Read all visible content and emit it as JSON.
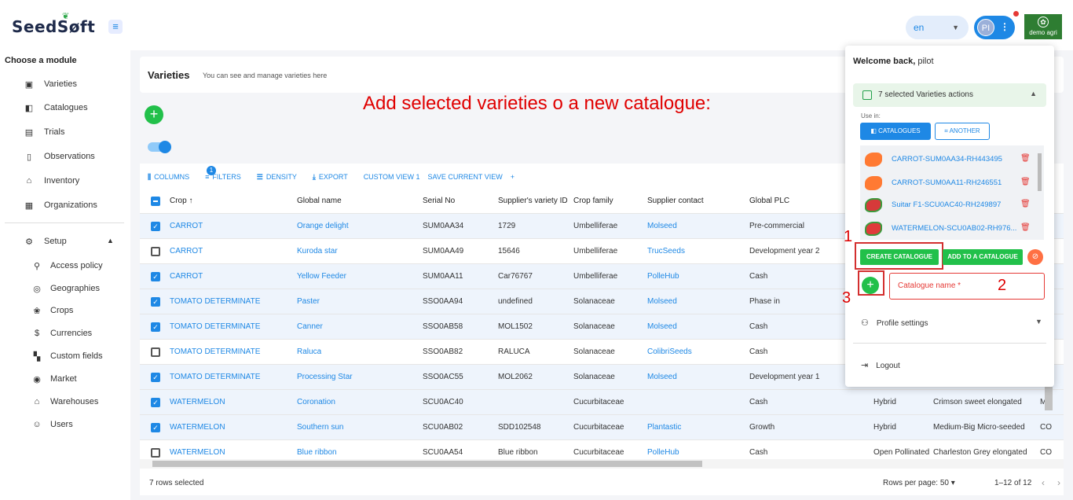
{
  "header": {
    "logo_text": "SeedSøft",
    "language": "en",
    "user_initials": "PI",
    "brand": "demo agri"
  },
  "sidebar": {
    "title": "Choose a module",
    "items": [
      {
        "label": "Varieties",
        "icon": "varieties-icon"
      },
      {
        "label": "Catalogues",
        "icon": "catalogues-icon"
      },
      {
        "label": "Trials",
        "icon": "trials-icon"
      },
      {
        "label": "Observations",
        "icon": "observations-icon"
      },
      {
        "label": "Inventory",
        "icon": "inventory-icon"
      },
      {
        "label": "Organizations",
        "icon": "organizations-icon"
      }
    ],
    "setup_label": "Setup",
    "setup_items": [
      {
        "label": "Access policy"
      },
      {
        "label": "Geographies"
      },
      {
        "label": "Crops"
      },
      {
        "label": "Currencies"
      },
      {
        "label": "Custom fields"
      },
      {
        "label": "Market"
      },
      {
        "label": "Warehouses"
      },
      {
        "label": "Users"
      }
    ]
  },
  "page": {
    "title": "Varieties",
    "subtitle": "You can see and manage varieties here",
    "annotation": "Add selected varieties o a new catalogue:"
  },
  "toolbar": {
    "columns": "COLUMNS",
    "filters": "FILTERS",
    "filter_count": "1",
    "density": "DENSITY",
    "export": "EXPORT",
    "custom_view": "CUSTOM VIEW 1",
    "save_view": "SAVE CURRENT VIEW",
    "add": "+"
  },
  "table": {
    "headers": [
      "Crop ↑",
      "Global name",
      "Serial No",
      "Supplier's variety ID",
      "Crop family",
      "Supplier contact",
      "Global PLC"
    ],
    "rows": [
      {
        "selected": true,
        "crop": "CARROT",
        "name": "Orange delight",
        "serial": "SUM0AA34",
        "supplier_id": "1729",
        "family": "Umbelliferae",
        "contact": "Molseed",
        "plc": "Pre-commercial",
        "extra1": "",
        "extra2": "",
        "extra3": ""
      },
      {
        "selected": false,
        "crop": "CARROT",
        "name": "Kuroda star",
        "serial": "SUM0AA49",
        "supplier_id": "15646",
        "family": "Umbelliferae",
        "contact": "TrucSeeds",
        "plc": "Development year 2",
        "extra1": "",
        "extra2": "",
        "extra3": ""
      },
      {
        "selected": true,
        "crop": "CARROT",
        "name": "Yellow Feeder",
        "serial": "SUM0AA11",
        "supplier_id": "Car76767",
        "family": "Umbelliferae",
        "contact": "PolleHub",
        "plc": "Cash",
        "extra1": "",
        "extra2": "",
        "extra3": ""
      },
      {
        "selected": true,
        "crop": "TOMATO DETERMINATE",
        "name": "Paster",
        "serial": "SSO0AA94",
        "supplier_id": "undefined",
        "family": "Solanaceae",
        "contact": "Molseed",
        "plc": "Phase in",
        "extra1": "",
        "extra2": "",
        "extra3": ""
      },
      {
        "selected": true,
        "crop": "TOMATO DETERMINATE",
        "name": "Canner",
        "serial": "SSO0AB58",
        "supplier_id": "MOL1502",
        "family": "Solanaceae",
        "contact": "Molseed",
        "plc": "Cash",
        "extra1": "",
        "extra2": "",
        "extra3": ""
      },
      {
        "selected": false,
        "crop": "TOMATO DETERMINATE",
        "name": "Raluca",
        "serial": "SSO0AB82",
        "supplier_id": "RALUCA",
        "family": "Solanaceae",
        "contact": "ColibriSeeds",
        "plc": "Cash",
        "extra1": "",
        "extra2": "",
        "extra3": ""
      },
      {
        "selected": true,
        "crop": "TOMATO DETERMINATE",
        "name": "Processing Star",
        "serial": "SSO0AC55",
        "supplier_id": "MOL2062",
        "family": "Solanaceae",
        "contact": "Molseed",
        "plc": "Development year 1",
        "extra1": "",
        "extra2": "",
        "extra3": ""
      },
      {
        "selected": true,
        "crop": "WATERMELON",
        "name": "Coronation",
        "serial": "SCU0AC40",
        "supplier_id": "",
        "family": "Cucurbitaceae",
        "contact": "",
        "plc": "Cash",
        "extra1": "Hybrid",
        "extra2": "Crimson sweet elongated",
        "extra3": "ME"
      },
      {
        "selected": true,
        "crop": "WATERMELON",
        "name": "Southern sun",
        "serial": "SCU0AB02",
        "supplier_id": "SDD102548",
        "family": "Cucurbitaceae",
        "contact": "Plantastic",
        "plc": "Growth",
        "extra1": "Hybrid",
        "extra2": "Medium-Big Micro-seeded",
        "extra3": "CO"
      },
      {
        "selected": false,
        "crop": "WATERMELON",
        "name": "Blue ribbon",
        "serial": "SCU0AA54",
        "supplier_id": "Blue ribbon",
        "family": "Cucurbitaceae",
        "contact": "PolleHub",
        "plc": "Cash",
        "extra1": "Open Pollinated",
        "extra2": "Charleston Grey elongated",
        "extra3": "CO"
      }
    ]
  },
  "footer": {
    "selected": "7 rows selected",
    "rows_per_page_label": "Rows per page:",
    "rows_per_page": "50",
    "range": "1–12 of 12",
    "prev": "‹",
    "next": "›"
  },
  "panel": {
    "welcome_prefix": "Welcome back,",
    "welcome_user": "pilot",
    "actions_label": "7 selected Varieties actions",
    "use_in": "Use in:",
    "catalogues_btn": "CATALOGUES",
    "another_btn": "ANOTHER",
    "list": [
      {
        "label": "CARROT-SUM0AA34-RH443495",
        "color": "#ff7a33"
      },
      {
        "label": "CARROT-SUM0AA11-RH246551",
        "color": "#ff7a33"
      },
      {
        "label": "Suitar F1-SCU0AC40-RH249897",
        "color": "#3c9a3c"
      },
      {
        "label": "WATERMELON-SCU0AB02-RH976...",
        "color": "#e03a3a"
      }
    ],
    "create_btn": "CREATE CATALOGUE",
    "addto_btn": "ADD TO A CATALOGUE",
    "catalogue_placeholder": "Catalogue name *",
    "profile": "Profile settings",
    "logout": "Logout",
    "marker1": "1",
    "marker2": "2",
    "marker3": "3"
  }
}
